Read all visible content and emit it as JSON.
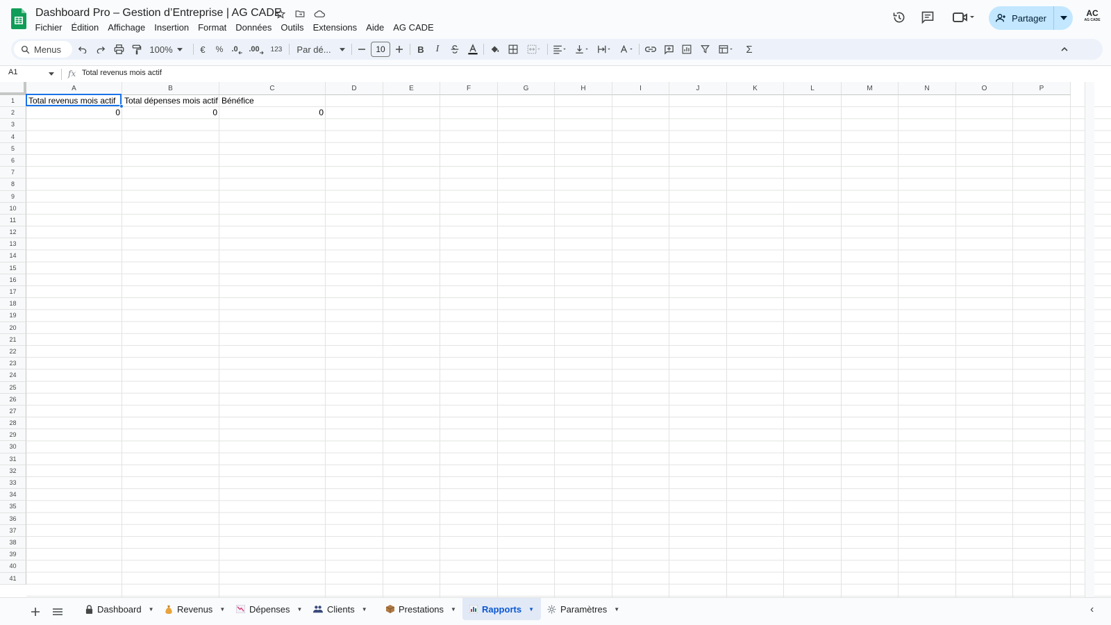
{
  "app": {
    "title": "Dashboard Pro – Gestion d’Entreprise | AG CADE",
    "account_initials": "AC",
    "account_sub": "AG CADE"
  },
  "menu": [
    "Fichier",
    "Édition",
    "Affichage",
    "Insertion",
    "Format",
    "Données",
    "Outils",
    "Extensions",
    "Aide",
    "AG CADE"
  ],
  "share": {
    "label": "Partager"
  },
  "toolbar": {
    "search_label": "Menus",
    "zoom": "100%",
    "currency": "€",
    "percent": "%",
    "dec_decrease": ".0",
    "dec_increase": ".00",
    "number_format": "123",
    "font_family": "Par dé...",
    "font_size": "10",
    "bold": "B",
    "italic": "I",
    "sigma": "Σ"
  },
  "formula_bar": {
    "cell_ref": "A1",
    "fx": "fx",
    "content": "Total revenus mois actif"
  },
  "grid": {
    "columns": [
      "A",
      "B",
      "C",
      "D",
      "E",
      "F",
      "G",
      "H",
      "I",
      "J",
      "K",
      "L",
      "M",
      "N",
      "O",
      "P"
    ],
    "rows": [
      "1",
      "2",
      "3",
      "4",
      "5",
      "6",
      "7",
      "8",
      "9",
      "10",
      "11",
      "12",
      "13",
      "14",
      "15",
      "16",
      "17",
      "18",
      "19",
      "20",
      "21",
      "22",
      "23",
      "24",
      "25",
      "26",
      "27",
      "28",
      "29",
      "30",
      "31",
      "32",
      "33",
      "34",
      "35",
      "36",
      "37",
      "38",
      "39",
      "40",
      "41"
    ],
    "cells": {
      "A1": "Total revenus mois actif",
      "B1": "Total dépenses mois actif",
      "C1": "Bénéfice",
      "A2": "0",
      "B2": "0",
      "C2": "0"
    },
    "selected": "A1"
  },
  "sheets": [
    {
      "name": "Dashboard",
      "icon": "lock-icon",
      "active": false
    },
    {
      "name": "Revenus",
      "icon": "money-bag-icon",
      "active": false
    },
    {
      "name": "Dépenses",
      "icon": "chart-down-icon",
      "active": false
    },
    {
      "name": "Clients",
      "icon": "people-icon",
      "active": false
    },
    {
      "name": "Prestations",
      "icon": "package-icon",
      "active": false
    },
    {
      "name": "Rapports",
      "icon": "bar-chart-icon",
      "active": true
    },
    {
      "name": "Paramètres",
      "icon": "gear-icon",
      "active": false
    }
  ],
  "colors": {
    "accent": "#0b57d0",
    "share_bg": "#c2e7ff",
    "selection": "#1a73e8",
    "sheets_green": "#0f9d58"
  }
}
